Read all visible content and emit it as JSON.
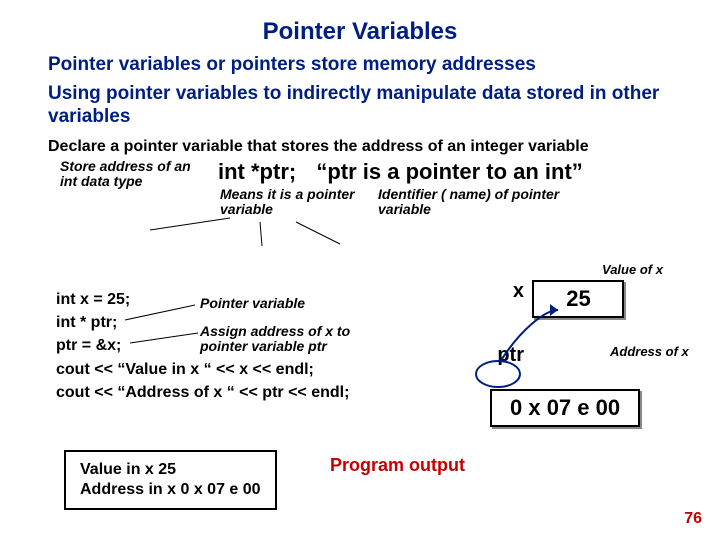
{
  "title": "Pointer Variables",
  "lead1": "Pointer variables or pointers store memory addresses",
  "lead2": "Using pointer variables to indirectly manipulate data stored in other variables",
  "sub1": "Declare a pointer variable that stores the address of an integer variable",
  "decl": {
    "code": "int *ptr;",
    "quote": "“ptr is a pointer to an int”"
  },
  "ann": {
    "left": "Store address of an int data type",
    "mid": "Means it is a pointer variable",
    "right": "Identifier ( name) of pointer variable"
  },
  "code": {
    "l1": "int x = 25;",
    "l2": "int * ptr;",
    "l3": "ptr = &x;",
    "l4": "cout << “Value in x “ << x << endl;",
    "l5": "cout << “Address of x “ << ptr << endl;"
  },
  "code_ann": {
    "pv": "Pointer variable",
    "assign": "Assign address of x to pointer variable ptr"
  },
  "boxes": {
    "xlabel": "x",
    "xval": "25",
    "xvalann": "Value of x",
    "ptrlabel": "ptr",
    "ptrval": "0 x 07 e 00",
    "ptraddrann": "Address of x"
  },
  "output": {
    "line1": "Value in x 25",
    "line2": "Address in x 0 x 07 e 00",
    "label": "Program output"
  },
  "pagenum": "76"
}
